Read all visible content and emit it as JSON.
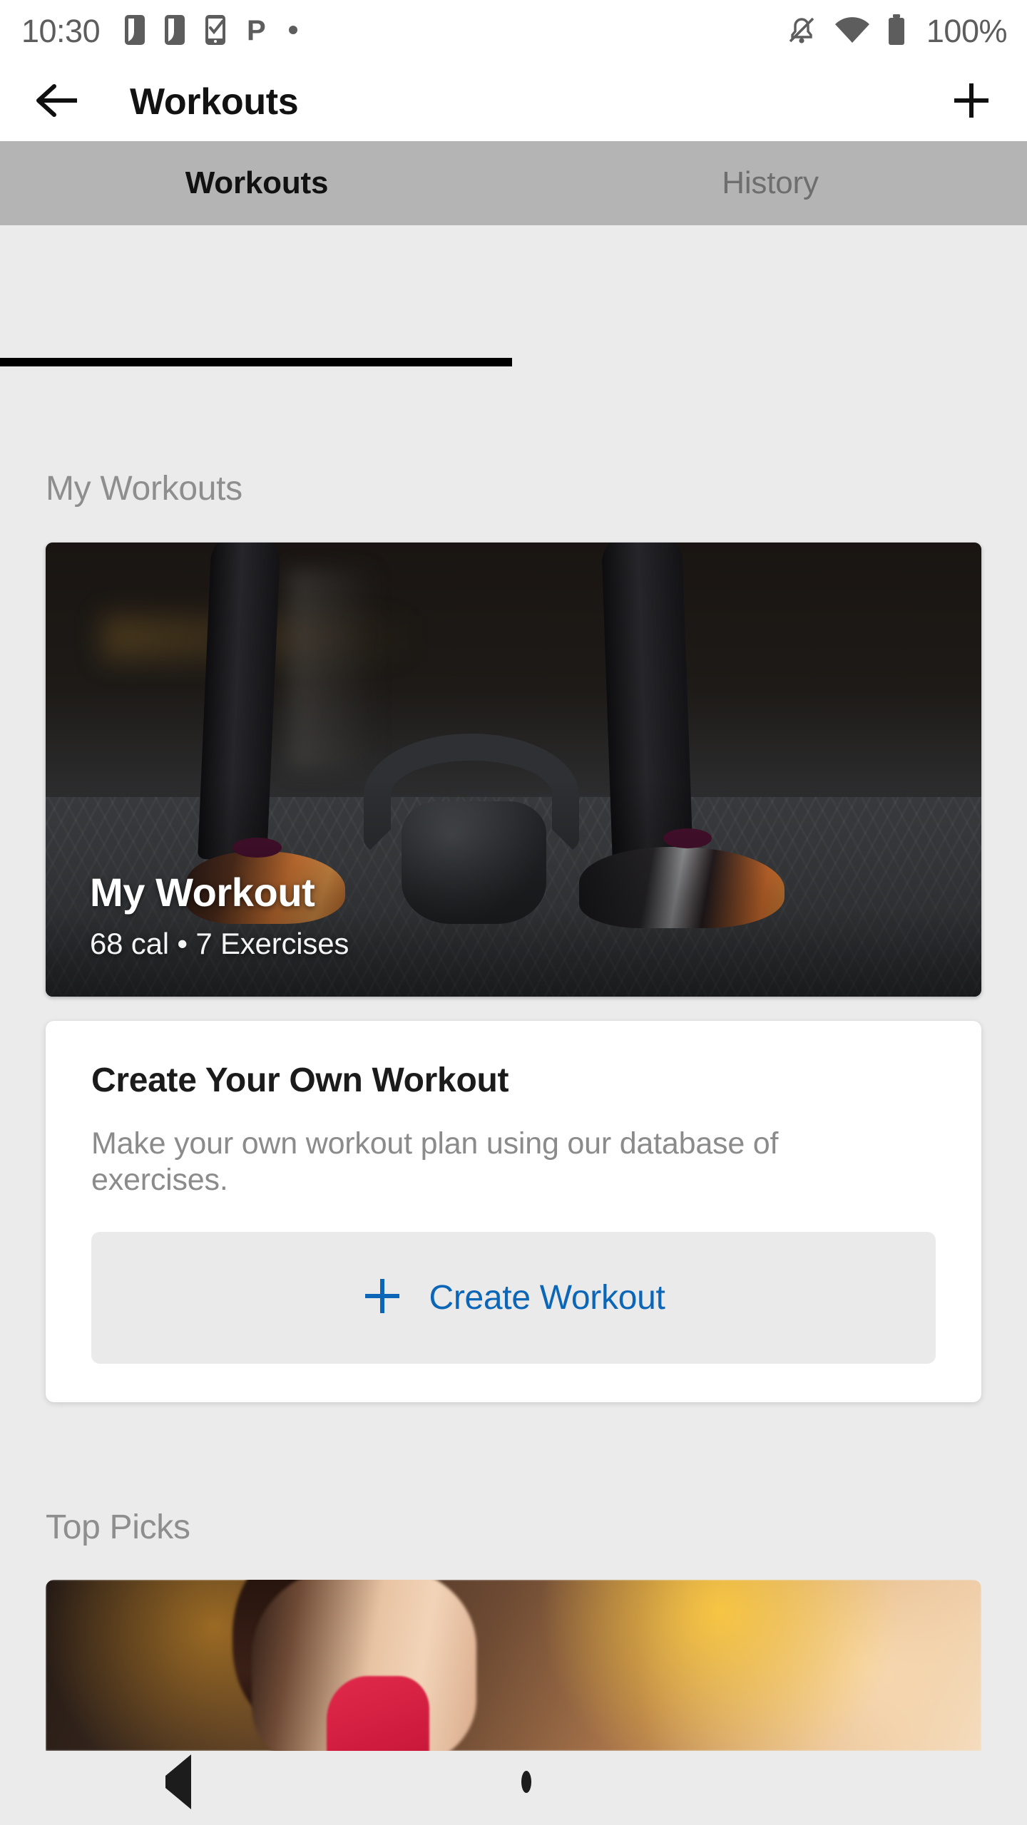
{
  "statusbar": {
    "time": "10:30",
    "battery_percent": "100%",
    "left_icons": [
      "sim-card-icon",
      "sim-card-icon",
      "task-complete-icon",
      "pinterest-icon",
      "dot-icon"
    ],
    "right_icons": [
      "notifications-off-icon",
      "wifi-icon",
      "battery-full-icon"
    ]
  },
  "appbar": {
    "back_icon": "arrow-back-icon",
    "title": "Workouts",
    "add_icon": "plus-icon"
  },
  "tabs": [
    {
      "label": "Workouts",
      "active": true
    },
    {
      "label": "History",
      "active": false
    }
  ],
  "sections": {
    "my_workouts": {
      "heading": "My Workouts",
      "workout_card": {
        "title": "My Workout",
        "subtitle": "68 cal • 7 Exercises",
        "calories": "68 cal",
        "exercise_count": "7 Exercises",
        "image": "kettlebell-training-shoes-photo"
      },
      "create_card": {
        "title": "Create Your Own Workout",
        "description": "Make your own workout plan using our database of exercises.",
        "button_label": "Create Workout",
        "button_icon": "plus-icon"
      }
    },
    "top_picks": {
      "heading": "Top Picks",
      "card_image": "woman-smiling-gym-photo"
    }
  },
  "navbar": {
    "back": "nav-back-icon",
    "home": "nav-home-icon",
    "recents": "nav-recents-icon"
  },
  "colors": {
    "accent_blue": "#0b66b8",
    "tabbar_gray": "#b4b4b4",
    "page_bg": "#ebebeb",
    "card_white": "#ffffff",
    "muted_text": "#8e8e8e"
  }
}
